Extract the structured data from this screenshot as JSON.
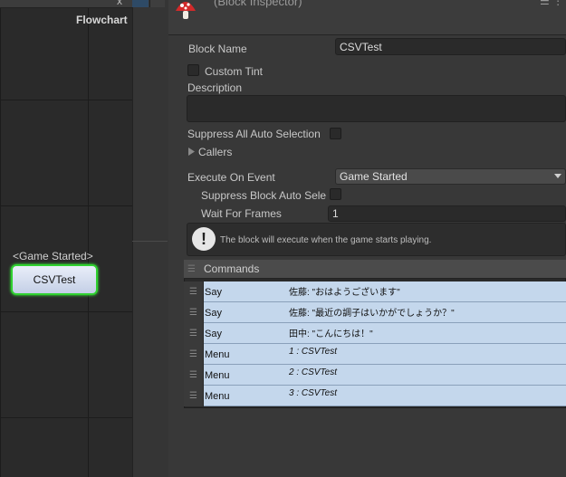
{
  "flowchart": {
    "title": "Flowchart",
    "close_glyph": "x",
    "block": {
      "event_label": "<Game Started>",
      "name": "CSVTest"
    }
  },
  "inspector": {
    "title": "(Block Inspector)",
    "more": "☰ ⋮",
    "fields": {
      "block_name_label": "Block Name",
      "block_name_value": "CSVTest",
      "custom_tint_label": "Custom Tint",
      "description_label": "Description",
      "description_value": "",
      "suppress_all_label": "Suppress All Auto Selection",
      "callers_label": "Callers",
      "execute_on_event_label": "Execute On Event",
      "execute_on_event_value": "Game Started",
      "suppress_block_label": "Suppress Block Auto Sele",
      "wait_frames_label": "Wait For Frames",
      "wait_frames_value": "1"
    },
    "help_text": "The block will execute when the game starts playing."
  },
  "commands": {
    "header": "Commands",
    "rows": [
      {
        "name": "Say",
        "summary": "佐藤: \"おはようございます\"",
        "italic": false
      },
      {
        "name": "Say",
        "summary": "佐藤: \"最近の調子はいかがでしょうか？\"",
        "italic": false
      },
      {
        "name": "Say",
        "summary": "田中: \"こんにちは！\"",
        "italic": false
      },
      {
        "name": "Menu",
        "summary": "1 : CSVTest",
        "italic": true
      },
      {
        "name": "Menu",
        "summary": "2 : CSVTest",
        "italic": true
      },
      {
        "name": "Menu",
        "summary": "3 : CSVTest",
        "italic": true
      }
    ]
  },
  "colors": {
    "selection_outline": "#2fd12f",
    "command_row_bg": "#c4d7ec",
    "mushroom_red": "#d22a2a"
  },
  "icons": {
    "mushroom": "fungus-mushroom-icon",
    "info": "info-exclamation-icon",
    "callers_toggle": "triangle-right-icon",
    "dropdown": "chevron-down-icon",
    "drag_handle": "drag-handle-icon"
  }
}
